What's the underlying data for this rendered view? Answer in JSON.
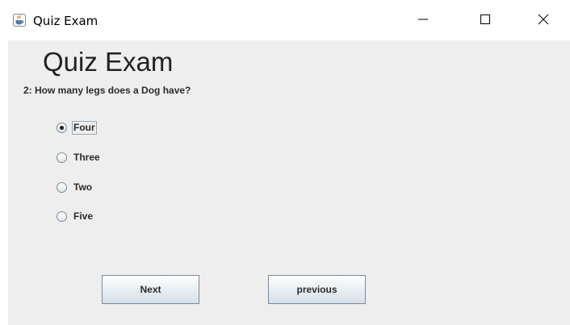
{
  "window": {
    "title": "Quiz Exam",
    "controls": {
      "minimize": "minimize-icon",
      "maximize": "maximize-icon",
      "close": "close-icon"
    }
  },
  "quiz": {
    "heading": "Quiz Exam",
    "question": "2: How many legs does a Dog have?",
    "options": [
      {
        "label": "Four",
        "selected": true
      },
      {
        "label": "Three",
        "selected": false
      },
      {
        "label": "Two",
        "selected": false
      },
      {
        "label": "Five",
        "selected": false
      }
    ],
    "buttons": {
      "next_label": "Next",
      "previous_label": "previous"
    }
  },
  "colors": {
    "content_background": "#eeeeee",
    "titlebar_background": "#ffffff",
    "text": "#2b2b2b"
  }
}
